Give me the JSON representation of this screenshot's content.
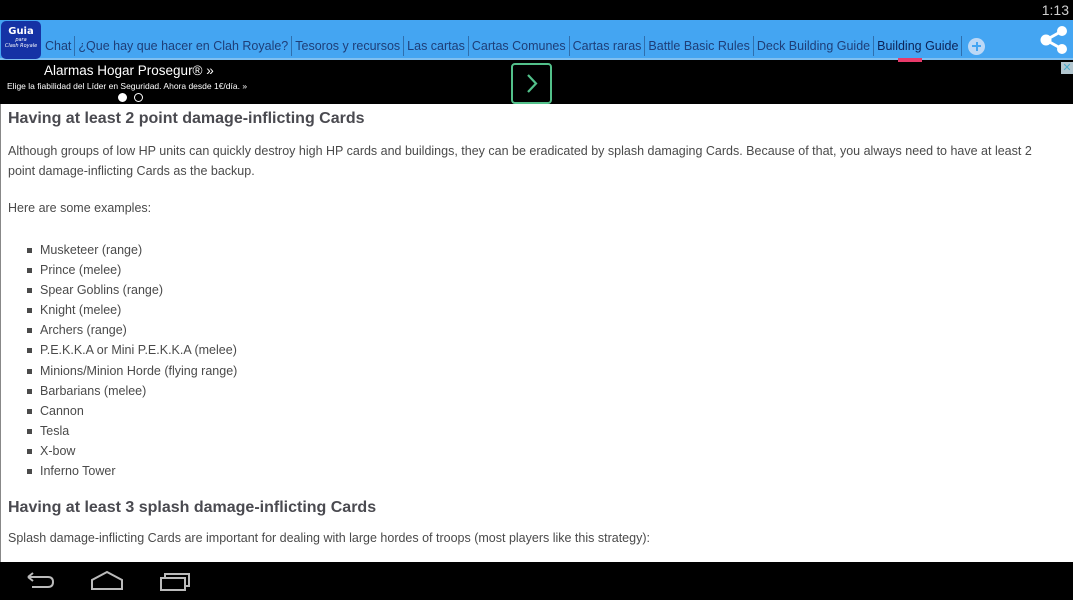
{
  "status_bar": {
    "time": "1:13"
  },
  "app_bar": {
    "logo": {
      "line1": "Guia",
      "line2": "para",
      "line3": "Clash Royale"
    },
    "tabs": [
      {
        "label": "Chat",
        "active": false
      },
      {
        "label": "¿Que hay que hacer en Clah Royale?",
        "active": false
      },
      {
        "label": "Tesoros y recursos",
        "active": false
      },
      {
        "label": "Las cartas",
        "active": false
      },
      {
        "label": "Cartas Comunes",
        "active": false
      },
      {
        "label": "Cartas raras",
        "active": false
      },
      {
        "label": "Battle Basic Rules",
        "active": false
      },
      {
        "label": "Deck Building Guide",
        "active": false
      },
      {
        "label": "Building Guide",
        "active": true
      }
    ],
    "add_tab_icon": "plus-circle-icon",
    "share_icon": "share-icon",
    "colors": {
      "bar": "#44a5f2",
      "active_indicator": "#e83a6a",
      "tab_text": "#1e3e78"
    }
  },
  "ad": {
    "title": "Alarmas Hogar Prosegur® »",
    "subtitle": "Elige la fiabilidad del Líder en Seguridad. Ahora desde 1€/día. »",
    "carousel": {
      "total": 2,
      "current": 1
    },
    "cta_icon": "chevron-right-icon",
    "close_label": "✕",
    "cta_color": "#52c08a"
  },
  "content": {
    "section1": {
      "heading": "Having at least 2 point damage-inflicting Cards",
      "paragraph": "Although groups of low HP units can quickly destroy high HP cards and buildings, they can be eradicated by splash damaging Cards. Because of that, you always need to have at least 2 point damage-inflicting Cards as the backup.",
      "intro": "Here are some examples:",
      "items": [
        "Musketeer (range)",
        "Prince (melee)",
        "Spear Goblins (range)",
        "Knight (melee)",
        "Archers (range)",
        "P.E.K.K.A or Mini P.E.K.K.A (melee)",
        "Minions/Minion Horde (flying range)",
        "Barbarians (melee)",
        "Cannon",
        "Tesla",
        "X-bow",
        "Inferno Tower"
      ]
    },
    "section2": {
      "heading": "Having at least 3 splash damage-inflicting Cards",
      "paragraph": "Splash damage-inflicting Cards are important for dealing with large hordes of troops (most players like this strategy):"
    }
  },
  "nav_bar": {
    "buttons": [
      {
        "name": "back",
        "icon": "back-icon"
      },
      {
        "name": "home",
        "icon": "home-icon"
      },
      {
        "name": "recents",
        "icon": "recents-icon"
      }
    ]
  }
}
